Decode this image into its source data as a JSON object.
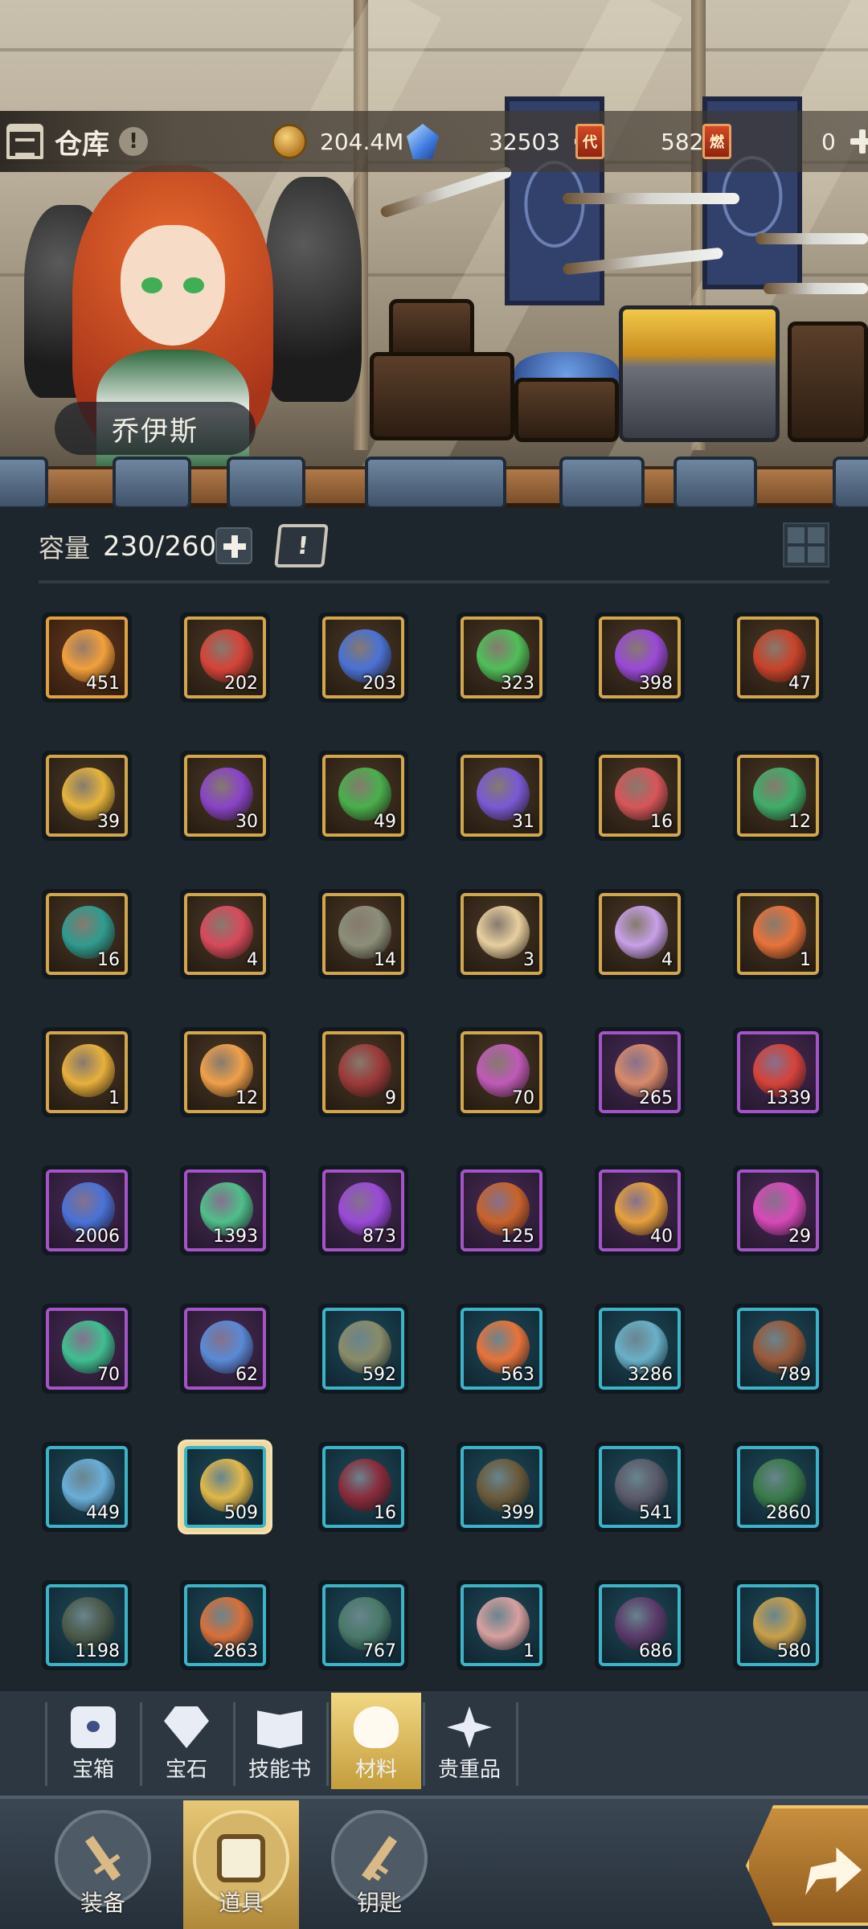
{
  "header": {
    "title": "仓库",
    "info_icon": "!",
    "resources": [
      {
        "icon": "coin-icon",
        "value": "204.4M"
      },
      {
        "icon": "gem-icon",
        "value": "32503",
        "has_plus": true
      },
      {
        "icon": "ticket-icon",
        "badge": "代",
        "value": "5820"
      },
      {
        "icon": "ticket-icon",
        "badge": "燃",
        "value": "0",
        "has_plus": true
      }
    ]
  },
  "hero": {
    "name": "乔伊斯"
  },
  "capacity": {
    "label": "容量",
    "value": "230/260"
  },
  "items": [
    {
      "count": "451",
      "rarity": "orange",
      "icon": "flame-rune-icon",
      "color": "#f2a03c"
    },
    {
      "count": "202",
      "rarity": "gold",
      "icon": "fist-rune-icon",
      "color": "#d6433a"
    },
    {
      "count": "203",
      "rarity": "gold",
      "icon": "shield-rune-icon",
      "color": "#4a72d6"
    },
    {
      "count": "323",
      "rarity": "gold",
      "icon": "leaf-rune-icon",
      "color": "#4fbf5a"
    },
    {
      "count": "398",
      "rarity": "gold",
      "icon": "void-rune-icon",
      "color": "#9a4ad8"
    },
    {
      "count": "47",
      "rarity": "gold",
      "icon": "tower-rune-icon",
      "color": "#c9432a"
    },
    {
      "count": "39",
      "rarity": "gold",
      "icon": "compass-rune-icon",
      "color": "#e6b43c"
    },
    {
      "count": "30",
      "rarity": "gold",
      "icon": "swirl-rune-icon",
      "color": "#8a44c8"
    },
    {
      "count": "49",
      "rarity": "gold",
      "icon": "droplet-rune-icon",
      "color": "#49b04c"
    },
    {
      "count": "31",
      "rarity": "gold",
      "icon": "lightning-rune-icon",
      "color": "#7a5ad6"
    },
    {
      "count": "16",
      "rarity": "gold",
      "icon": "crystal-flower-icon",
      "color": "#d8565a"
    },
    {
      "count": "12",
      "rarity": "gold",
      "icon": "green-crystal-icon",
      "color": "#3fae6a"
    },
    {
      "count": "16",
      "rarity": "gold",
      "icon": "teal-orb-icon",
      "color": "#2f9c90"
    },
    {
      "count": "4",
      "rarity": "gold",
      "icon": "red-sprout-icon",
      "color": "#d84a5c"
    },
    {
      "count": "14",
      "rarity": "gold",
      "icon": "rat-icon",
      "color": "#8c8f7a"
    },
    {
      "count": "3",
      "rarity": "gold",
      "icon": "gold-heart-icon",
      "color": "#e8cfa0"
    },
    {
      "count": "4",
      "rarity": "gold",
      "icon": "purple-heart-icon",
      "color": "#c8a0e8"
    },
    {
      "count": "1",
      "rarity": "gold",
      "icon": "fire-egg-icon",
      "color": "#e8733a"
    },
    {
      "count": "1",
      "rarity": "gold",
      "icon": "golden-drop-icon",
      "color": "#e8b03c"
    },
    {
      "count": "12",
      "rarity": "gold",
      "icon": "spiral-shell-icon",
      "color": "#f0a04a"
    },
    {
      "count": "9",
      "rarity": "gold",
      "icon": "sprout-bulb-icon",
      "color": "#9c3a3a"
    },
    {
      "count": "70",
      "rarity": "gold",
      "icon": "lotus-icon",
      "color": "#c05ab8"
    },
    {
      "count": "265",
      "rarity": "purple",
      "icon": "meat-icon",
      "color": "#d88a6a"
    },
    {
      "count": "1339",
      "rarity": "purple",
      "icon": "fist-rune-icon",
      "color": "#d6433a"
    },
    {
      "count": "2006",
      "rarity": "purple",
      "icon": "shield-rune-icon",
      "color": "#4a72d6"
    },
    {
      "count": "1393",
      "rarity": "purple",
      "icon": "leaf-rune-icon",
      "color": "#4fbf8a"
    },
    {
      "count": "873",
      "rarity": "purple",
      "icon": "void-rune-icon",
      "color": "#9a4ad8"
    },
    {
      "count": "125",
      "rarity": "purple",
      "icon": "tower-rune-icon",
      "color": "#c9632a"
    },
    {
      "count": "40",
      "rarity": "purple",
      "icon": "compass-rune-icon",
      "color": "#e6a03c"
    },
    {
      "count": "29",
      "rarity": "purple",
      "icon": "swirl-rune-icon",
      "color": "#d84ab8"
    },
    {
      "count": "70",
      "rarity": "purple",
      "icon": "droplet-rune-icon",
      "color": "#3fbf90"
    },
    {
      "count": "62",
      "rarity": "purple",
      "icon": "lightning-rune-icon",
      "color": "#5a8ad6"
    },
    {
      "count": "592",
      "rarity": "teal",
      "icon": "hooded-rat-icon",
      "color": "#8a8c6a"
    },
    {
      "count": "563",
      "rarity": "teal",
      "icon": "fire-skull-icon",
      "color": "#e8733a"
    },
    {
      "count": "3286",
      "rarity": "teal",
      "icon": "ice-lizard-icon",
      "color": "#6ab0c8"
    },
    {
      "count": "789",
      "rarity": "teal",
      "icon": "lion-beast-icon",
      "color": "#9a5a3a"
    },
    {
      "count": "449",
      "rarity": "teal",
      "icon": "water-spirit-icon",
      "color": "#6aaed8"
    },
    {
      "count": "509",
      "rarity": "teal",
      "icon": "golden-knight-icon",
      "color": "#e0b84a",
      "selected": true
    },
    {
      "count": "16",
      "rarity": "teal",
      "icon": "dark-dragon-icon",
      "color": "#8a2a3a"
    },
    {
      "count": "399",
      "rarity": "teal",
      "icon": "tree-spirit-icon",
      "color": "#6a5a3a"
    },
    {
      "count": "541",
      "rarity": "teal",
      "icon": "shadow-wolf-icon",
      "color": "#5a5a6a"
    },
    {
      "count": "2860",
      "rarity": "teal",
      "icon": "goblin-icon",
      "color": "#3a7a4a"
    },
    {
      "count": "1198",
      "rarity": "teal",
      "icon": "cat-beast-icon",
      "color": "#4a5a4a"
    },
    {
      "count": "2863",
      "rarity": "teal",
      "icon": "fire-warrior-icon",
      "color": "#d8703a"
    },
    {
      "count": "767",
      "rarity": "teal",
      "icon": "elf-icon",
      "color": "#4a7a6a"
    },
    {
      "count": "1",
      "rarity": "teal",
      "icon": "girl-hero-icon",
      "color": "#d8a0a0"
    },
    {
      "count": "686",
      "rarity": "teal",
      "icon": "spider-icon",
      "color": "#5a3a6a"
    },
    {
      "count": "580",
      "rarity": "teal",
      "icon": "bird-monster-icon",
      "color": "#c8a04a"
    }
  ],
  "categories": [
    {
      "label": "宝箱",
      "icon": "chest-icon",
      "active": false
    },
    {
      "label": "宝石",
      "icon": "diamond-icon",
      "active": false
    },
    {
      "label": "技能书",
      "icon": "book-icon",
      "active": false
    },
    {
      "label": "材料",
      "icon": "material-icon",
      "active": true
    },
    {
      "label": "贵重品",
      "icon": "star-icon",
      "active": false
    }
  ],
  "nav": [
    {
      "label": "装备",
      "icon": "sword-icon",
      "active": false
    },
    {
      "label": "道具",
      "icon": "treasure-chest-icon",
      "active": true
    },
    {
      "label": "钥匙",
      "icon": "key-icon",
      "active": false
    }
  ]
}
